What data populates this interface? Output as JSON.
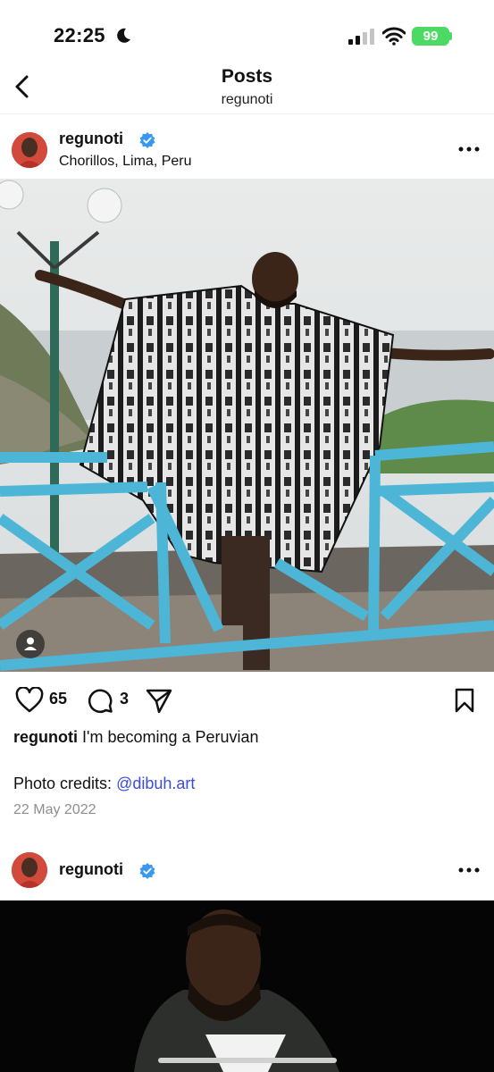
{
  "status_bar": {
    "time": "22:25",
    "battery": "99"
  },
  "nav": {
    "title": "Posts",
    "subtitle": "regunoti"
  },
  "post1": {
    "username": "regunoti",
    "location": "Chorillos, Lima, Peru",
    "likes": "65",
    "comments": "3",
    "caption_user": "regunoti",
    "caption_text": "I'm becoming a Peruvian",
    "credits_label": "Photo credits:",
    "credits_link": "@dibuh.art",
    "date": "22 May 2022"
  },
  "post2": {
    "username": "regunoti"
  },
  "colors": {
    "link": "#3b4bdc",
    "verified": "#3897f0",
    "battery": "#4cd964",
    "railing": "#4db6d6"
  },
  "icons": [
    "moon-icon",
    "signal-icon",
    "wifi-icon",
    "back-icon",
    "verified-icon",
    "more-icon",
    "person-tag-icon",
    "heart-icon",
    "comment-icon",
    "share-icon",
    "bookmark-icon"
  ]
}
